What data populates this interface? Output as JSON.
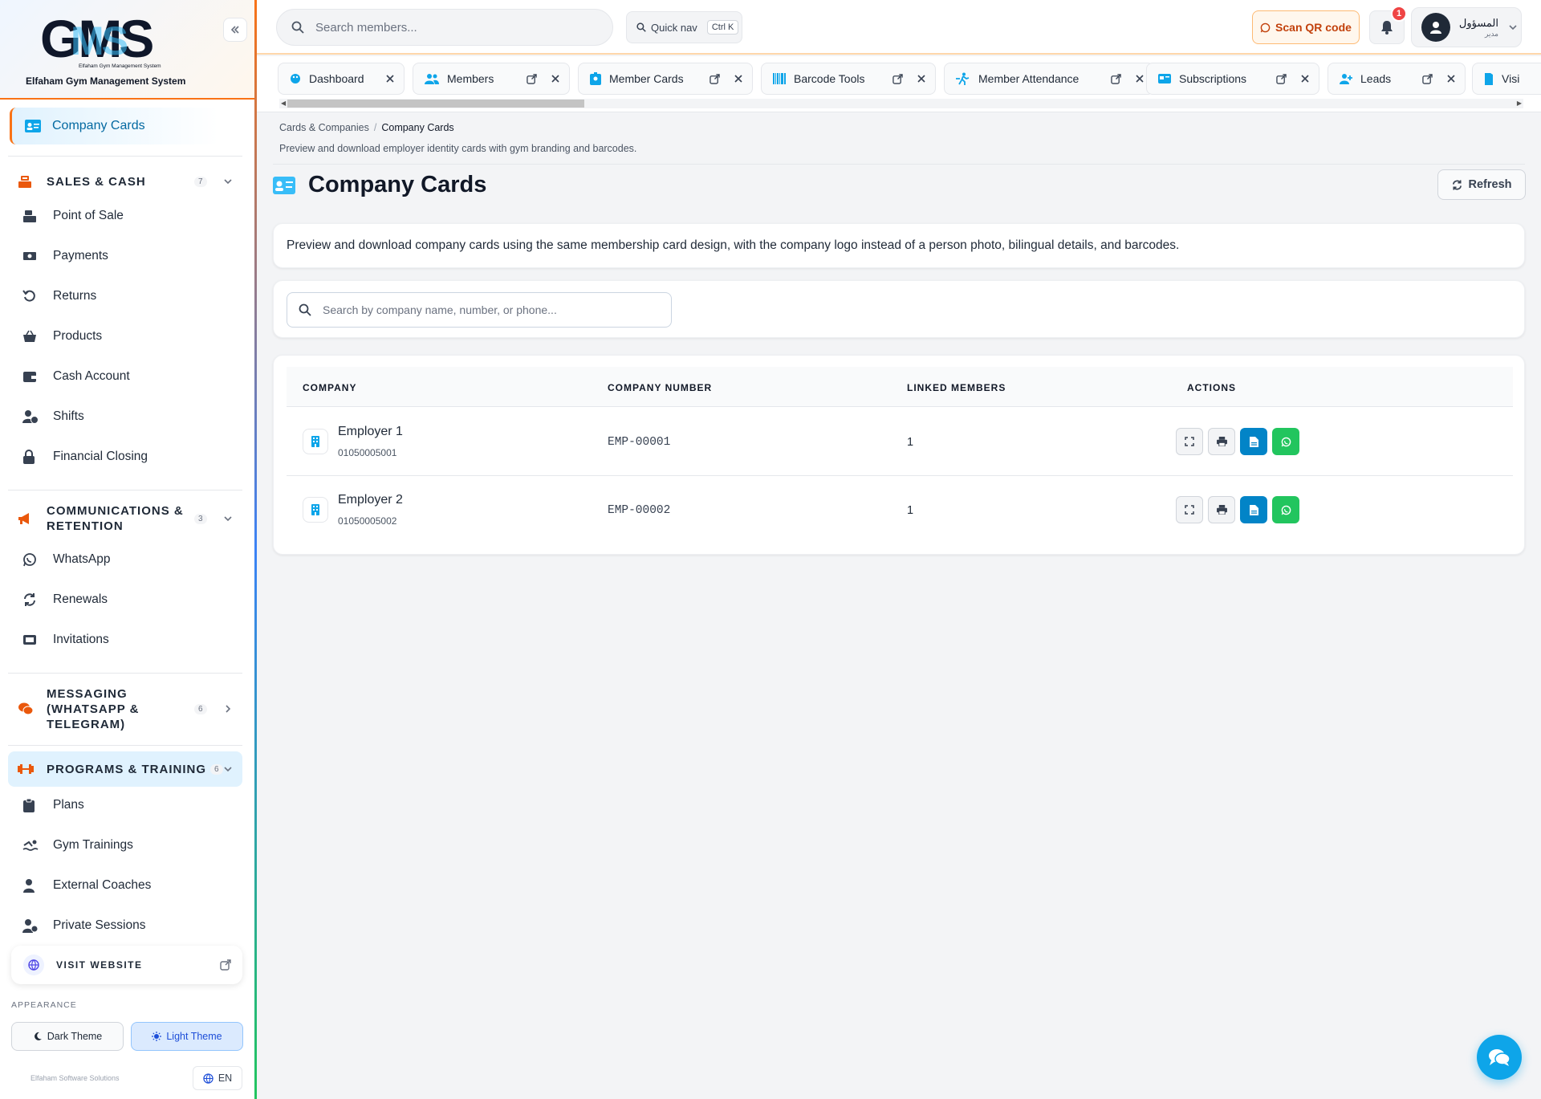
{
  "sidebar": {
    "logo_text": "GMS",
    "logo_tagline": "Elfaham Gym Management System",
    "system_name": "Elfaham Gym Management System",
    "active_item": "Company Cards",
    "groups": [
      {
        "title": "SALES & CASH",
        "count": "7",
        "expanded": true,
        "icon": "cash-register-icon",
        "items": [
          {
            "label": "Point of Sale",
            "icon": "cash-register-icon"
          },
          {
            "label": "Payments",
            "icon": "money-icon"
          },
          {
            "label": "Returns",
            "icon": "undo-icon"
          },
          {
            "label": "Products",
            "icon": "basket-icon"
          },
          {
            "label": "Cash Account",
            "icon": "wallet-icon"
          },
          {
            "label": "Shifts",
            "icon": "clock-user-icon"
          },
          {
            "label": "Financial Closing",
            "icon": "lock-icon"
          }
        ]
      },
      {
        "title": "COMMUNICATIONS & RETENTION",
        "count": "3",
        "expanded": true,
        "icon": "megaphone-icon",
        "items": [
          {
            "label": "WhatsApp",
            "icon": "whatsapp-icon"
          },
          {
            "label": "Renewals",
            "icon": "refresh-icon"
          },
          {
            "label": "Invitations",
            "icon": "ticket-icon"
          }
        ]
      },
      {
        "title": "MESSAGING (WHATSAPP & TELEGRAM)",
        "count": "6",
        "expanded": false,
        "icon": "chat-icon",
        "items": []
      },
      {
        "title": "PROGRAMS & TRAINING",
        "count": "6",
        "expanded": true,
        "icon": "dumbbell-icon",
        "items": [
          {
            "label": "Plans",
            "icon": "clipboard-icon"
          },
          {
            "label": "Gym Trainings",
            "icon": "swimmer-icon"
          },
          {
            "label": "External Coaches",
            "icon": "user-tie-icon"
          },
          {
            "label": "Private Sessions",
            "icon": "user-gear-icon"
          }
        ]
      }
    ],
    "visit_website": "VISIT WEBSITE",
    "appearance_label": "APPEARANCE",
    "dark_theme": "Dark Theme",
    "light_theme": "Light Theme",
    "company": "Elfaham Software Solutions",
    "language": "EN"
  },
  "header": {
    "search_placeholder": "Search members...",
    "quick_nav": "Quick nav",
    "quick_nav_kbd": "Ctrl K",
    "scan_qr": "Scan QR code",
    "notifications": "1",
    "user_name": "المسؤول",
    "user_role": "مدير"
  },
  "tabs": [
    {
      "label": "Dashboard",
      "icon": "palette-icon"
    },
    {
      "label": "Members",
      "icon": "users-icon"
    },
    {
      "label": "Member Cards",
      "icon": "id-badge-icon"
    },
    {
      "label": "Barcode Tools",
      "icon": "barcode-icon"
    },
    {
      "label": "Member Attendance",
      "icon": "walking-icon"
    },
    {
      "label": "Subscriptions",
      "icon": "card-icon"
    },
    {
      "label": "Leads",
      "icon": "user-plus-icon"
    },
    {
      "label": "Visi",
      "icon": "door-icon"
    }
  ],
  "breadcrumb": {
    "parent": "Cards & Companies",
    "current": "Company Cards"
  },
  "page": {
    "description": "Preview and download employer identity cards with gym branding and barcodes.",
    "title": "Company Cards",
    "refresh": "Refresh",
    "info": "Preview and download company cards using the same membership card design, with the company logo instead of a person photo, bilingual details, and barcodes.",
    "filter_placeholder": "Search by company name, number, or phone..."
  },
  "table": {
    "columns": [
      "COMPANY",
      "COMPANY NUMBER",
      "LINKED MEMBERS",
      "ACTIONS"
    ],
    "rows": [
      {
        "name": "Employer 1",
        "phone": "01050005001",
        "number": "EMP-00001",
        "linked": "1"
      },
      {
        "name": "Employer 2",
        "phone": "01050005002",
        "number": "EMP-00002",
        "linked": "1"
      }
    ]
  },
  "colors": {
    "accent": "#0ea5e9",
    "brand_orange": "#f97316",
    "whatsapp": "#22c55e",
    "pdf_blue": "#0284c7"
  }
}
